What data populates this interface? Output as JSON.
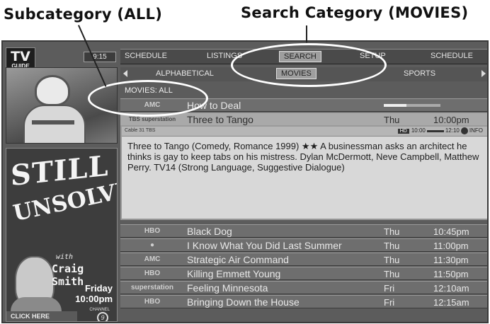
{
  "callouts": {
    "subcategory": "Subcategory (ALL)",
    "search_category": "Search Category (MOVIES)"
  },
  "branding": {
    "logo_line1": "TV",
    "logo_line2": "GUIDE",
    "channel_button": "9:15"
  },
  "topnav": [
    "SCHEDULE",
    "LISTINGS",
    "SEARCH",
    "SETUP",
    "SCHEDULE"
  ],
  "topnav_active": "SEARCH",
  "subnav": [
    "ALPHABETICAL",
    "MOVIES",
    "SPORTS"
  ],
  "subnav_active": "MOVIES",
  "list_header": "MOVIES: ALL",
  "rows_top": [
    {
      "logo": "AMC",
      "title": "How to Deal",
      "day": "",
      "time": "",
      "progress": 0.4
    },
    {
      "logo": "TBS superstation",
      "title": "Three to Tango",
      "day": "Thu",
      "time": "10:00pm",
      "selected": true
    }
  ],
  "detail": {
    "cable": "Cable 31 TBS",
    "meta_badge": "HD",
    "meta_start": "10:00",
    "meta_end": "12:10",
    "meta_info": "INFO",
    "description": "Three to Tango (Comedy, Romance 1999) ★★ A businessman asks an architect he thinks is gay to keep tabs on his mistress. Dylan McDermott, Neve Campbell, Matthew Perry. TV14 (Strong Language, Suggestive Dialogue)"
  },
  "rows_bottom": [
    {
      "logo": "HBO",
      "title": "Black Dog",
      "day": "Thu",
      "time": "10:45pm"
    },
    {
      "logo": "●",
      "title": "I Know What You Did Last Summer",
      "day": "Thu",
      "time": "11:00pm"
    },
    {
      "logo": "AMC",
      "title": "Strategic Air Command",
      "day": "Thu",
      "time": "11:30pm"
    },
    {
      "logo": "HBO",
      "title": "Killing Emmett Young",
      "day": "Thu",
      "time": "11:50pm"
    },
    {
      "logo": "superstation",
      "title": "Feeling Minnesota",
      "day": "Fri",
      "time": "12:10am"
    },
    {
      "logo": "HBO",
      "title": "Bringing Down the House",
      "day": "Fri",
      "time": "12:15am"
    }
  ],
  "ad": {
    "title1": "STILL",
    "title2": "UNSOLVED",
    "with": "with",
    "host": "Craig Smith",
    "day": "Friday",
    "time": "10:00pm",
    "channel_label": "CHANNEL",
    "channel_number": "9",
    "cta": "CLICK HERE"
  }
}
